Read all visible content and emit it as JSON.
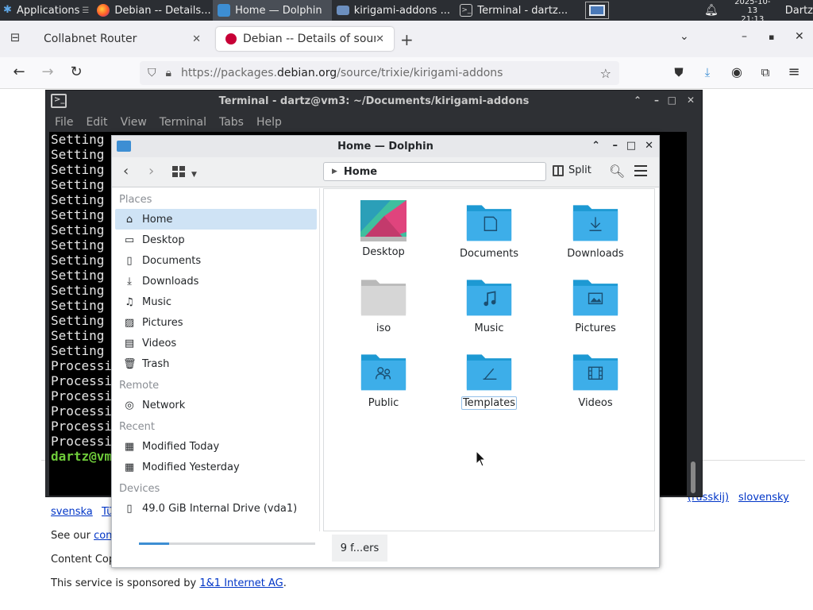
{
  "panel": {
    "applications_label": "Applications",
    "tasks": [
      {
        "label": "Debian -- Details..."
      },
      {
        "label": "Home — Dolphin"
      },
      {
        "label": "kirigami-addons ..."
      },
      {
        "label": "Terminal - dartz..."
      }
    ],
    "date": "2025-10-13",
    "time": "21:13",
    "user": "Dartz"
  },
  "firefox": {
    "tabs": [
      {
        "label": "Collabnet Router"
      },
      {
        "label": "Debian -- Details of sour"
      }
    ],
    "url_prefix": "https://packages.",
    "url_domain": "debian.org",
    "url_suffix": "/source/trixie/kirigami-addons"
  },
  "webpage": {
    "lang_links_row1": [
      "slovensky"
    ],
    "lang_links_row1b": "(russkij)",
    "lang_row2": [
      "svenska",
      "Tü"
    ],
    "see_our": "See our",
    "see_our_link": "cont",
    "content_cop": "Content Cop",
    "sponsor_text": "This service is sponsored by",
    "sponsor_link": "1&1 Internet AG",
    "sponsor_end": "."
  },
  "terminal": {
    "title": "Terminal - dartz@vm3: ~/Documents/kirigami-addons",
    "menu": [
      "File",
      "Edit",
      "View",
      "Terminal",
      "Tabs",
      "Help"
    ],
    "lines": [
      "Setting",
      "Setting",
      "Setting",
      "Setting",
      "Setting",
      "Setting",
      "Setting",
      "Setting",
      "Setting",
      "Setting",
      "Setting",
      "Setting",
      "Setting",
      "Setting",
      "Setting",
      "Processi",
      "Processi",
      "Processi",
      "Processi",
      "Processi",
      "Processi"
    ],
    "prompt": "dartz@vm"
  },
  "dolphin": {
    "title": "Home — Dolphin",
    "breadcrumb": "Home",
    "split_label": "Split",
    "places": {
      "section_places": "Places",
      "items": [
        {
          "label": "Home",
          "icon": "home-icon"
        },
        {
          "label": "Desktop",
          "icon": "desktop-icon"
        },
        {
          "label": "Documents",
          "icon": "documents-icon"
        },
        {
          "label": "Downloads",
          "icon": "downloads-icon"
        },
        {
          "label": "Music",
          "icon": "music-icon"
        },
        {
          "label": "Pictures",
          "icon": "pictures-icon"
        },
        {
          "label": "Videos",
          "icon": "videos-icon"
        },
        {
          "label": "Trash",
          "icon": "trash-icon"
        }
      ],
      "section_remote": "Remote",
      "remote": [
        {
          "label": "Network",
          "icon": "network-icon"
        }
      ],
      "section_recent": "Recent",
      "recent": [
        {
          "label": "Modified Today",
          "icon": "calendar-icon"
        },
        {
          "label": "Modified Yesterday",
          "icon": "calendar-icon"
        }
      ],
      "section_devices": "Devices",
      "devices": [
        {
          "label": "49.0 GiB Internal Drive (vda1)",
          "icon": "drive-icon",
          "usage_fraction": 0.17
        }
      ]
    },
    "files": [
      {
        "label": "Desktop",
        "icon": "desktop-folder-icon"
      },
      {
        "label": "Documents",
        "icon": "documents-folder-icon"
      },
      {
        "label": "Downloads",
        "icon": "downloads-folder-icon"
      },
      {
        "label": "iso",
        "icon": "folder-icon"
      },
      {
        "label": "Music",
        "icon": "music-folder-icon"
      },
      {
        "label": "Pictures",
        "icon": "pictures-folder-icon"
      },
      {
        "label": "Public",
        "icon": "public-folder-icon"
      },
      {
        "label": "Templates",
        "icon": "templates-folder-icon"
      },
      {
        "label": "Videos",
        "icon": "videos-folder-icon"
      }
    ],
    "status": "9 f...ers"
  },
  "colors": {
    "panel_bg": "#2b2e33",
    "folder_blue": "#3daee9",
    "folder_blue_dark": "#1d99d3",
    "selection": "#cfe3f5",
    "link": "#0035c7",
    "prompt_green": "#6ecb3a"
  }
}
